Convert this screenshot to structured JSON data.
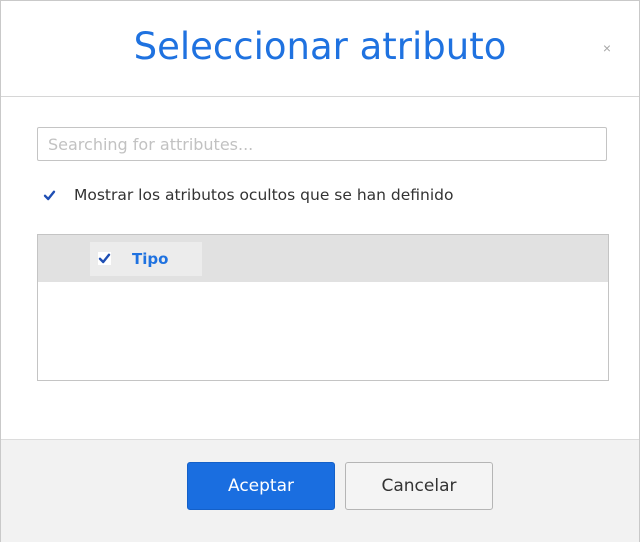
{
  "dialog": {
    "title": "Seleccionar atributo",
    "close_glyph": "×"
  },
  "search": {
    "placeholder": "Searching for attributes...",
    "value": ""
  },
  "show_hidden": {
    "label": "Mostrar los atributos ocultos que se han definido",
    "checked": true
  },
  "attributes": [
    {
      "label": "Tipo",
      "checked": true
    }
  ],
  "footer": {
    "accept_label": "Aceptar",
    "cancel_label": "Cancelar"
  },
  "colors": {
    "accent": "#1f72e0",
    "primary_button": "#1a6ee0",
    "row_highlight": "#e1e1e1"
  },
  "icons": {
    "close": "close-icon",
    "check": "checkmark-icon"
  }
}
